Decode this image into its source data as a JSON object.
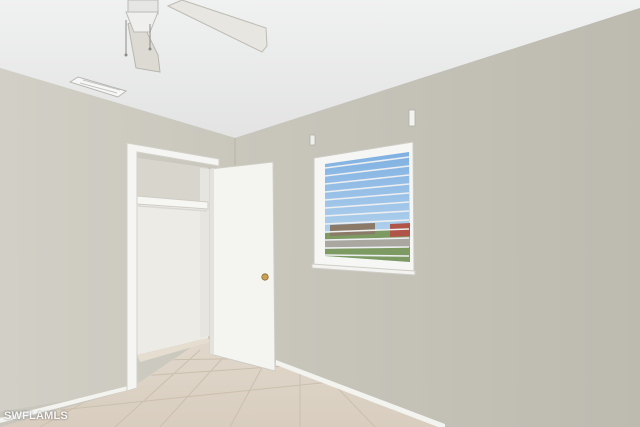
{
  "scene": {
    "type": "photo",
    "subject": "empty-bedroom",
    "objects": [
      "ceiling-fan",
      "air-vent",
      "closet",
      "open-door",
      "window-with-blinds",
      "tile-floor",
      "baseboard",
      "light-switch"
    ]
  },
  "watermark": {
    "text": "SWFLAMLS"
  },
  "colors": {
    "wall_right": "#c6c4b8",
    "wall_left": "#cfcdc3",
    "ceiling": "#e9eaea",
    "floor": "#ddd3c6",
    "trim": "#f4f4f2",
    "sky": "#9cc2e6"
  }
}
